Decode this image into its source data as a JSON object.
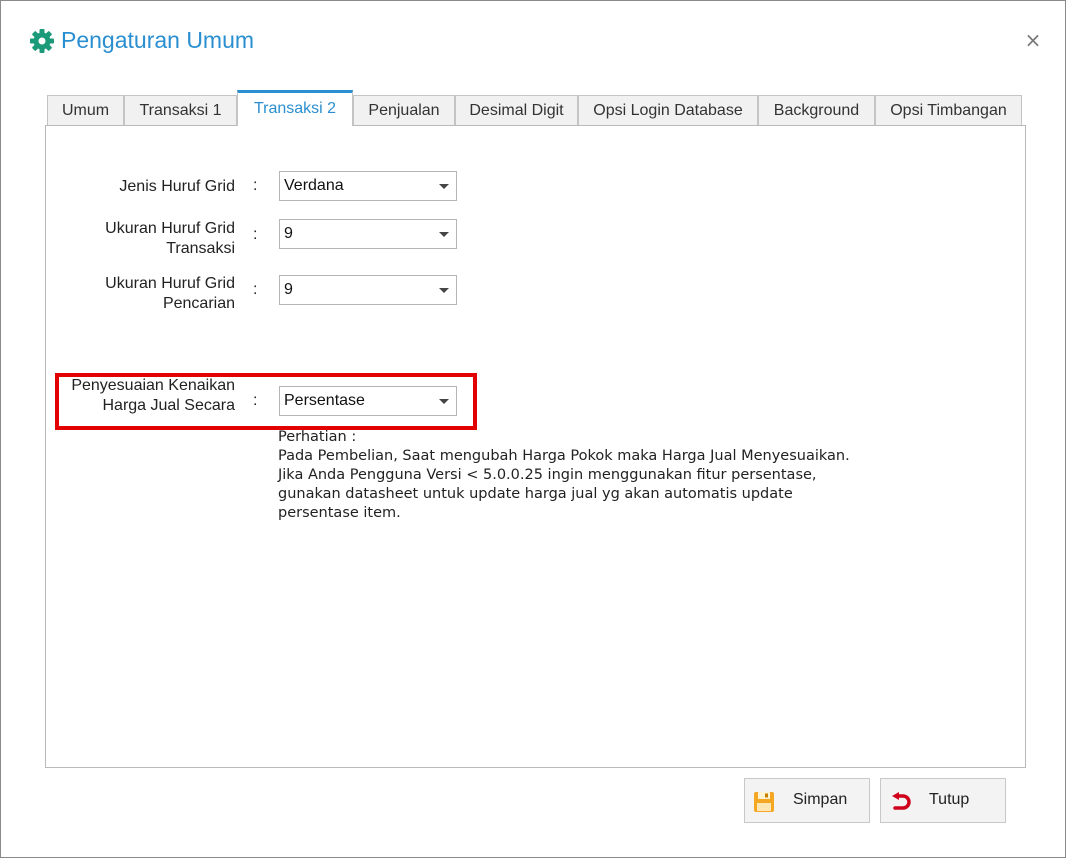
{
  "window": {
    "title": "Pengaturan Umum",
    "close_label": "×"
  },
  "tabs": [
    {
      "label": "Umum",
      "active": false
    },
    {
      "label": "Transaksi 1",
      "active": false
    },
    {
      "label": "Transaksi 2",
      "active": true
    },
    {
      "label": "Penjualan",
      "active": false
    },
    {
      "label": "Desimal Digit",
      "active": false
    },
    {
      "label": "Opsi Login Database",
      "active": false
    },
    {
      "label": "Background",
      "active": false
    },
    {
      "label": "Opsi Timbangan",
      "active": false
    }
  ],
  "form": {
    "separator": ":",
    "jenis_huruf_grid": {
      "label": "Jenis Huruf Grid",
      "value": "Verdana"
    },
    "ukuran_transaksi": {
      "label_line1": "Ukuran Huruf Grid",
      "label_line2": "Transaksi",
      "value": "9"
    },
    "ukuran_pencarian": {
      "label_line1": "Ukuran Huruf Grid",
      "label_line2": "Pencarian",
      "value": "9"
    },
    "penyesuaian": {
      "label_line1": "Penyesuaian Kenaikan",
      "label_line2": "Harga Jual Secara",
      "value": "Persentase"
    }
  },
  "note": {
    "line1": "Perhatian :",
    "line2": "Pada Pembelian, Saat mengubah Harga Pokok maka Harga Jual Menyesuaikan.",
    "line3": "Jika Anda Pengguna Versi < 5.0.0.25 ingin menggunakan fitur persentase,",
    "line4": "gunakan datasheet untuk update harga jual yg akan automatis update",
    "line5": "persentase item."
  },
  "buttons": {
    "simpan": "Simpan",
    "tutup": "Tutup"
  },
  "colors": {
    "accent": "#2a8fd0",
    "highlight": "#e30000",
    "gear": "#1a9a78",
    "save_icon": "#f5a623",
    "close_icon": "#d0021b"
  },
  "icons": {
    "title": "gear-icon",
    "save": "floppy-disk-icon",
    "close": "undo-arrow-icon"
  }
}
